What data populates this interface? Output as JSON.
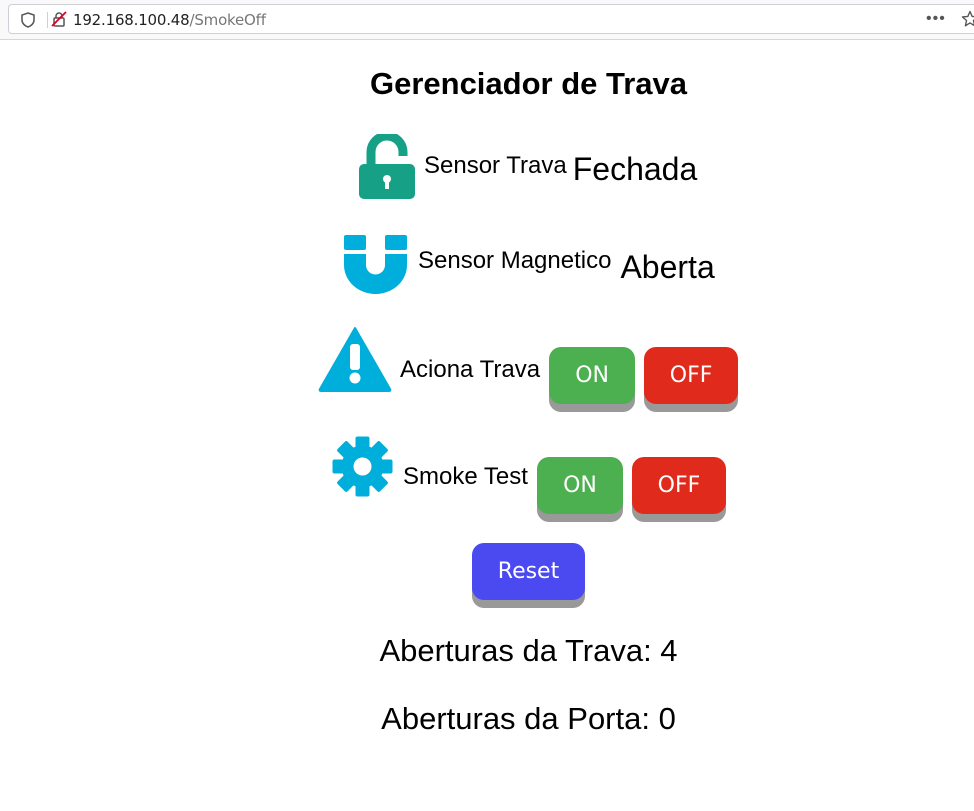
{
  "browser": {
    "url_host": "192.168.100.48",
    "url_path": "/SmokeOff",
    "more_icon": "more-icon",
    "star_icon": "star-icon"
  },
  "page": {
    "title": "Gerenciador de Trava",
    "sensor_trava": {
      "label": "Sensor Trava",
      "value": "Fechada",
      "icon": "unlock-icon"
    },
    "sensor_magnetico": {
      "label": "Sensor Magnetico",
      "value": "Aberta",
      "icon": "magnet-icon"
    },
    "aciona_trava": {
      "label": "Aciona Trava",
      "on": "ON",
      "off": "OFF",
      "icon": "warning-icon"
    },
    "smoke_test": {
      "label": "Smoke Test",
      "on": "ON",
      "off": "OFF",
      "icon": "gear-icon"
    },
    "reset_label": "Reset",
    "aberturas_trava": "Aberturas da Trava: 4",
    "aberturas_porta": "Aberturas da Porta: 0"
  },
  "colors": {
    "icon_teal": "#16a085",
    "icon_blue": "#00aedb",
    "on_green": "#4caf50",
    "off_red": "#e02b1c",
    "reset_blue": "#4a4af0"
  }
}
